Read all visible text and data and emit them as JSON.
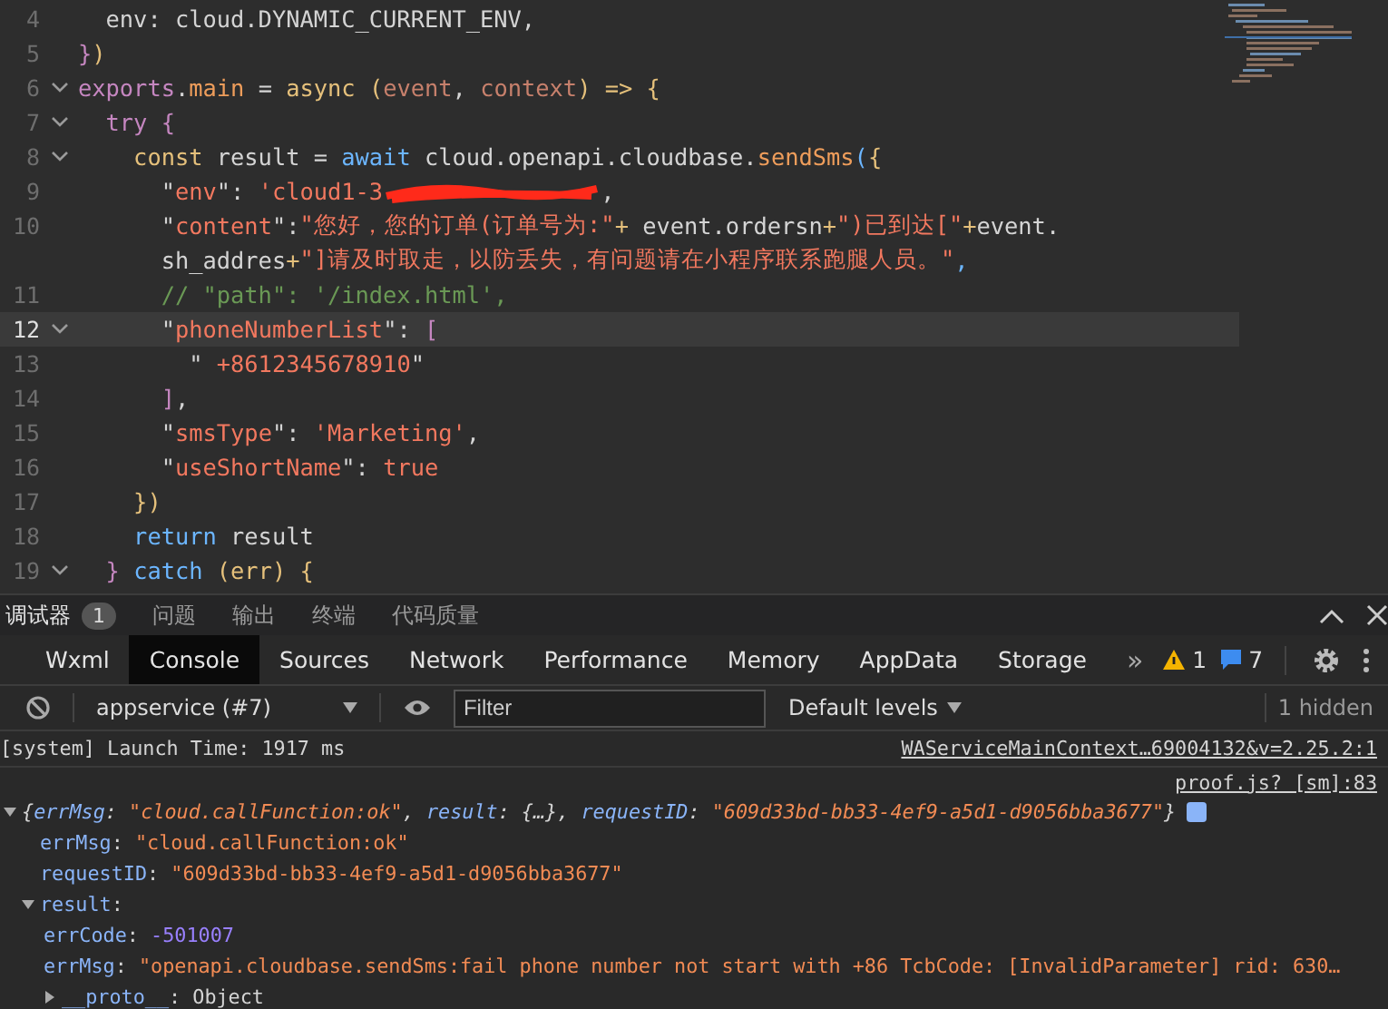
{
  "editor": {
    "lines": [
      {
        "number": "4",
        "fold": false,
        "highlighted": false,
        "tokens": [
          {
            "kind": "text",
            "t": "  env: cloud.DYNAMIC_CURRENT_ENV,"
          }
        ]
      },
      {
        "number": "5",
        "fold": false,
        "highlighted": false,
        "tokens": [
          {
            "kind": "kw",
            "t": "}"
          },
          {
            "kind": "yellow",
            "t": ")"
          }
        ]
      },
      {
        "number": "6",
        "fold": true,
        "highlighted": false,
        "tokens": [
          {
            "kind": "kw",
            "t": "exports"
          },
          {
            "kind": "text",
            "t": "."
          },
          {
            "kind": "fn",
            "t": "main"
          },
          {
            "kind": "text",
            "t": " = "
          },
          {
            "kind": "yellow",
            "t": "async"
          },
          {
            "kind": "yellow",
            "t": " ("
          },
          {
            "kind": "param",
            "t": "event"
          },
          {
            "kind": "text",
            "t": ", "
          },
          {
            "kind": "param",
            "t": "context"
          },
          {
            "kind": "yellow",
            "t": ")"
          },
          {
            "kind": "yellow",
            "t": " => {"
          }
        ]
      },
      {
        "number": "7",
        "fold": true,
        "highlighted": false,
        "tokens": [
          {
            "kind": "kw",
            "t": "  try"
          },
          {
            "kind": "kw",
            "t": " {"
          }
        ]
      },
      {
        "number": "8",
        "fold": true,
        "highlighted": false,
        "tokens": [
          {
            "kind": "yellow",
            "t": "    const"
          },
          {
            "kind": "text",
            "t": " result = "
          },
          {
            "kind": "blue",
            "t": "await"
          },
          {
            "kind": "text",
            "t": " cloud.openapi.cloudbase."
          },
          {
            "kind": "fn",
            "t": "sendSms"
          },
          {
            "kind": "blue",
            "t": "("
          },
          {
            "kind": "yellow",
            "t": "{"
          }
        ]
      },
      {
        "number": "9",
        "fold": false,
        "highlighted": false,
        "tokens": [
          {
            "kind": "text",
            "t": "      \""
          },
          {
            "kind": "str",
            "t": "env"
          },
          {
            "kind": "text",
            "t": "\": "
          },
          {
            "kind": "str",
            "t": "'cloud1-3"
          },
          {
            "kind": "redacted"
          },
          {
            "kind": "text",
            "t": ","
          }
        ]
      },
      {
        "number": "10",
        "fold": false,
        "highlighted": false,
        "tokens": [
          {
            "kind": "text",
            "t": "      \""
          },
          {
            "kind": "str",
            "t": "content"
          },
          {
            "kind": "text",
            "t": "\":"
          },
          {
            "kind": "str",
            "t": "\"您好，您的订单(订单号为:\""
          },
          {
            "kind": "yellow",
            "t": "+ "
          },
          {
            "kind": "text",
            "t": "event.ordersn"
          },
          {
            "kind": "yellow",
            "t": "+"
          },
          {
            "kind": "str",
            "t": "\")已到达[\""
          },
          {
            "kind": "yellow",
            "t": "+"
          },
          {
            "kind": "text",
            "t": "event."
          }
        ]
      },
      {
        "fold": false,
        "highlighted": false,
        "tokens": [
          {
            "kind": "text",
            "t": "      sh_addres"
          },
          {
            "kind": "yellow",
            "t": "+"
          },
          {
            "kind": "str",
            "t": "\"]请及时取走，以防丢失，有问题请在小程序联系跑腿人员。\""
          },
          {
            "kind": "blue",
            "t": ","
          }
        ]
      },
      {
        "number": "11",
        "fold": false,
        "highlighted": false,
        "tokens": [
          {
            "kind": "comment",
            "t": "      // \"path\": '/index.html',"
          }
        ]
      },
      {
        "number": "12",
        "fold": true,
        "highlighted": true,
        "tokens": [
          {
            "kind": "text",
            "t": "      \""
          },
          {
            "kind": "str",
            "t": "phoneNumberList"
          },
          {
            "kind": "text",
            "t": "\": "
          },
          {
            "kind": "kw",
            "t": "["
          }
        ]
      },
      {
        "number": "13",
        "fold": false,
        "highlighted": false,
        "tokens": [
          {
            "kind": "text",
            "t": "        \""
          },
          {
            "kind": "str",
            "t": " +8612345678910"
          },
          {
            "kind": "text",
            "t": "\""
          }
        ]
      },
      {
        "number": "14",
        "fold": false,
        "highlighted": false,
        "tokens": [
          {
            "kind": "kw",
            "t": "      ]"
          },
          {
            "kind": "text",
            "t": ","
          }
        ]
      },
      {
        "number": "15",
        "fold": false,
        "highlighted": false,
        "tokens": [
          {
            "kind": "text",
            "t": "      \""
          },
          {
            "kind": "str",
            "t": "smsType"
          },
          {
            "kind": "text",
            "t": "\": "
          },
          {
            "kind": "str",
            "t": "'Marketing'"
          },
          {
            "kind": "text",
            "t": ","
          }
        ]
      },
      {
        "number": "16",
        "fold": false,
        "highlighted": false,
        "tokens": [
          {
            "kind": "text",
            "t": "      \""
          },
          {
            "kind": "str",
            "t": "useShortName"
          },
          {
            "kind": "text",
            "t": "\": "
          },
          {
            "kind": "str",
            "t": "true"
          }
        ]
      },
      {
        "number": "17",
        "fold": false,
        "highlighted": false,
        "tokens": [
          {
            "kind": "yellow",
            "t": "    })"
          }
        ]
      },
      {
        "number": "18",
        "fold": false,
        "highlighted": false,
        "tokens": [
          {
            "kind": "blue",
            "t": "    return"
          },
          {
            "kind": "text",
            "t": " result"
          }
        ]
      },
      {
        "number": "19",
        "fold": true,
        "highlighted": false,
        "tokens": [
          {
            "kind": "kw",
            "t": "  } "
          },
          {
            "kind": "blue",
            "t": "catch"
          },
          {
            "kind": "yellow",
            "t": " (err) {"
          }
        ]
      }
    ]
  },
  "panel_tabs": [
    {
      "label": "调试器",
      "selected": true,
      "badge": "1"
    },
    {
      "label": "问题",
      "selected": false
    },
    {
      "label": "输出",
      "selected": false
    },
    {
      "label": "终端",
      "selected": false
    },
    {
      "label": "代码质量",
      "selected": false
    }
  ],
  "devtools_tabs": [
    {
      "label": "Wxml",
      "selected": false
    },
    {
      "label": "Console",
      "selected": true
    },
    {
      "label": "Sources",
      "selected": false
    },
    {
      "label": "Network",
      "selected": false
    },
    {
      "label": "Performance",
      "selected": false
    },
    {
      "label": "Memory",
      "selected": false
    },
    {
      "label": "AppData",
      "selected": false
    },
    {
      "label": "Storage",
      "selected": false
    }
  ],
  "more_tabs": "»",
  "warnings": "1",
  "messages": "7",
  "filter_bar": {
    "context": "appservice (#7)",
    "filter_placeholder": "Filter",
    "levels": "Default levels",
    "hidden": "1 hidden"
  },
  "console": {
    "launch": {
      "text": "[system] Launch Time: 1917 ms",
      "source": "WAServiceMainContext…69004132&v=2.25.2:1"
    },
    "source": "proof.js? [sm]:83",
    "object": {
      "expanded": true,
      "summary": [
        {
          "kind": "text",
          "t": "{"
        },
        {
          "kind": "key",
          "t": "errMsg"
        },
        {
          "kind": "text",
          "t": ": "
        },
        {
          "kind": "str",
          "t": "\"cloud.callFunction:ok\""
        },
        {
          "kind": "text",
          "t": ", "
        },
        {
          "kind": "key",
          "t": "result"
        },
        {
          "kind": "text",
          "t": ": {…}, "
        },
        {
          "kind": "key",
          "t": "requestID"
        },
        {
          "kind": "text",
          "t": ": "
        },
        {
          "kind": "str",
          "t": "\"609d33bd-bb33-4ef9-a5d1-d9056bba3677\""
        },
        {
          "kind": "text",
          "t": "}"
        }
      ],
      "children": [
        {
          "key": "errMsg",
          "sep": ": ",
          "value": "\"cloud.callFunction:ok\"",
          "kind": "str"
        },
        {
          "key": "requestID",
          "sep": ": ",
          "value": "\"609d33bd-bb33-4ef9-a5d1-d9056bba3677\"",
          "kind": "str"
        },
        {
          "key": "result",
          "sep": ":",
          "expanded": true,
          "children": [
            {
              "key": "errCode",
              "sep": ": ",
              "value": "-501007",
              "kind": "num"
            },
            {
              "key": "errMsg",
              "sep": ": ",
              "value": "\"openapi.cloudbase.sendSms:fail phone number not start with +86 TcbCode: [InvalidParameter] rid: 630…",
              "kind": "str"
            },
            {
              "key": "__proto__",
              "sep": ": ",
              "value": "Object",
              "kind": "plain",
              "expanded": false
            }
          ]
        }
      ]
    }
  }
}
